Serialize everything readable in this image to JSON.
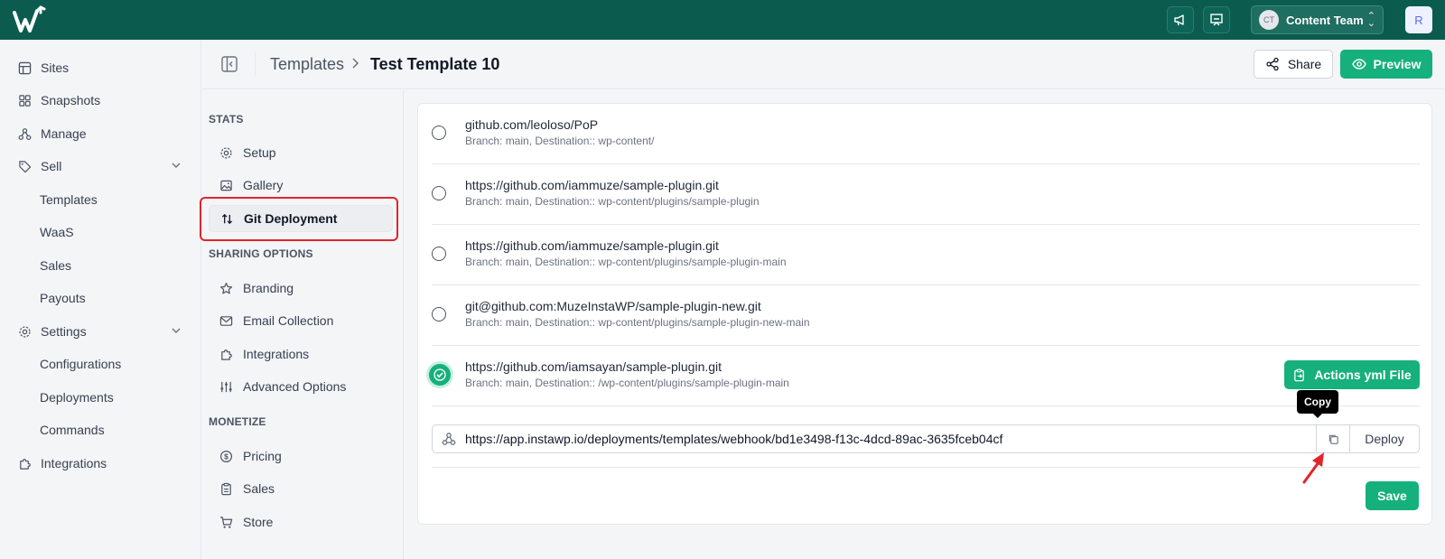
{
  "topbar": {
    "team": {
      "avatar": "CT",
      "label": "Content Team"
    },
    "user_avatar": "R",
    "icons": [
      "logo-icon",
      "megaphone-icon",
      "presentation-icon",
      "chevron-updown-icon"
    ]
  },
  "sidebar": {
    "items": [
      {
        "label": "Sites",
        "icon": "layout-icon"
      },
      {
        "label": "Snapshots",
        "icon": "grid-icon"
      },
      {
        "label": "Manage",
        "icon": "network-icon"
      },
      {
        "label": "Sell",
        "icon": "tag-icon"
      },
      {
        "label": "Templates"
      },
      {
        "label": "WaaS"
      },
      {
        "label": "Sales"
      },
      {
        "label": "Payouts"
      },
      {
        "label": "Settings",
        "icon": "gear-icon"
      },
      {
        "label": "Configurations"
      },
      {
        "label": "Deployments"
      },
      {
        "label": "Commands"
      },
      {
        "label": "Integrations",
        "icon": "puzzle-icon"
      }
    ]
  },
  "header": {
    "breadcrumb_parent": "Templates",
    "breadcrumb_current": "Test Template 10",
    "share_label": "Share",
    "preview_label": "Preview"
  },
  "subnav": {
    "sections": [
      "STATS",
      "SHARING OPTIONS",
      "MONETIZE"
    ],
    "items": [
      {
        "label": "Setup",
        "icon": "gear-icon"
      },
      {
        "label": "Gallery",
        "icon": "image-icon"
      },
      {
        "label": "Git Deployment",
        "icon": "arrows-updown-icon",
        "active": true
      },
      {
        "label": "Branding",
        "icon": "star-icon"
      },
      {
        "label": "Email Collection",
        "icon": "mail-icon"
      },
      {
        "label": "Integrations",
        "icon": "puzzle-icon"
      },
      {
        "label": "Advanced Options",
        "icon": "sliders-icon"
      },
      {
        "label": "Pricing",
        "icon": "dollar-circle-icon"
      },
      {
        "label": "Sales",
        "icon": "clipboard-icon"
      },
      {
        "label": "Store",
        "icon": "cart-icon"
      }
    ]
  },
  "repos": [
    {
      "url": "github.com/leoloso/PoP",
      "meta": "Branch: main, Destination:: wp-content/",
      "selected": false
    },
    {
      "url": "https://github.com/iammuze/sample-plugin.git",
      "meta": "Branch: main, Destination:: wp-content/plugins/sample-plugin",
      "selected": false
    },
    {
      "url": "https://github.com/iammuze/sample-plugin.git",
      "meta": "Branch: main, Destination:: wp-content/plugins/sample-plugin-main",
      "selected": false
    },
    {
      "url": "git@github.com:MuzeInstaWP/sample-plugin-new.git",
      "meta": "Branch: main, Destination:: wp-content/plugins/sample-plugin-new-main",
      "selected": false
    },
    {
      "url": "https://github.com/iamsayan/sample-plugin.git",
      "meta": "Branch: main, Destination:: /wp-content/plugins/sample-plugin-main",
      "selected": true
    }
  ],
  "actions_yml_label": "Actions yml File",
  "webhook": {
    "url": "https://app.instawp.io/deployments/templates/webhook/bd1e3498-f13c-4dcd-89ac-3635fceb04cf",
    "copy_tooltip": "Copy",
    "deploy_label": "Deploy"
  },
  "save_label": "Save",
  "colors": {
    "brand_dark": "#0b5c4f",
    "accent": "#16b07c",
    "highlight": "#e0252c"
  }
}
